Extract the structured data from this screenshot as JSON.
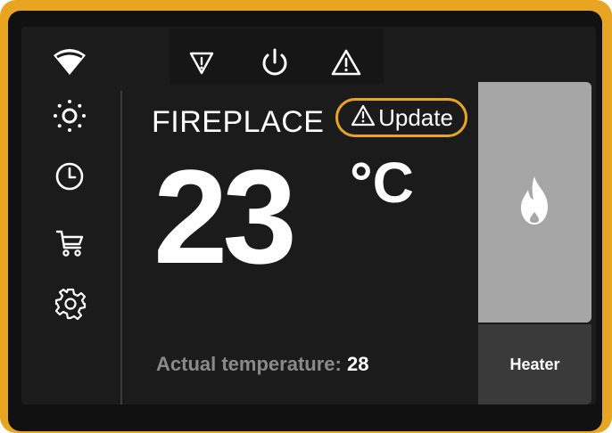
{
  "device": {
    "title": "FIREPLACE",
    "update_label": "Update"
  },
  "status_icons": [
    "filter-warning-icon",
    "power-icon",
    "warning-icon"
  ],
  "sidebar": {
    "items": [
      {
        "icon": "wifi-icon"
      },
      {
        "icon": "brightness-icon"
      },
      {
        "icon": "clock-icon"
      },
      {
        "icon": "cart-icon"
      },
      {
        "icon": "gear-icon"
      }
    ]
  },
  "temperature": {
    "set_value": "23",
    "unit": "°C",
    "actual_label": "Actual temperature:",
    "actual_value": "28"
  },
  "heater": {
    "icon": "flame-icon",
    "label": "Heater"
  },
  "colors": {
    "accent": "#e8a521",
    "background": "#1b1b1b",
    "tile": "#a6a6a6",
    "tile_label_bg": "#3a3a3a",
    "muted_text": "#8a8a8a"
  }
}
